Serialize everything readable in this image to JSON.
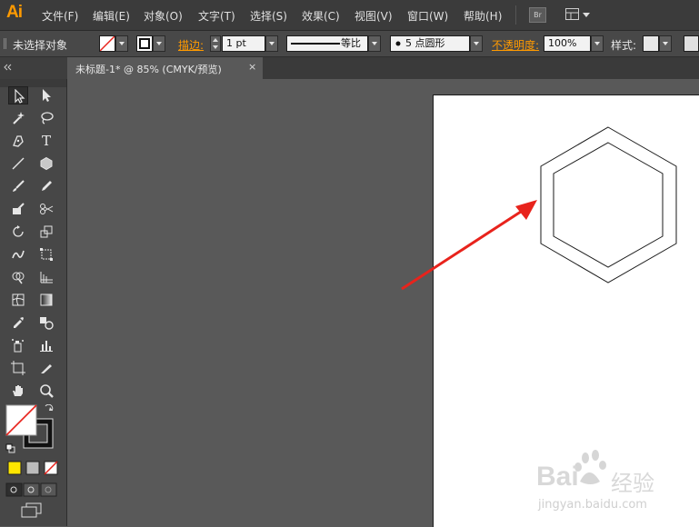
{
  "app": {
    "logo": "Ai",
    "menu": [
      "文件(F)",
      "编辑(E)",
      "对象(O)",
      "文字(T)",
      "选择(S)",
      "效果(C)",
      "视图(V)",
      "窗口(W)",
      "帮助(H)"
    ],
    "bridge_button": "Br"
  },
  "control_bar": {
    "selection_status": "未选择对象",
    "stroke_label": "描边:",
    "stroke_weight": "1 pt",
    "stroke_profile": "等比",
    "brush": "5 点圆形",
    "opacity_label": "不透明度:",
    "opacity_value": "100%",
    "style_label": "样式:"
  },
  "document": {
    "tab_title": "未标题-1* @ 85% (CMYK/预览)",
    "tab_close": "×"
  },
  "watermark": {
    "brand_left": "Bai",
    "brand_right": "经验",
    "url": "jingyan.baidu.com"
  },
  "colors": {
    "accent_orange": "#ff9a00",
    "arrow_red": "#e8231c"
  },
  "icons": [
    "selection-tool-icon",
    "direct-selection-tool-icon",
    "magic-wand-icon",
    "lasso-icon",
    "pen-icon",
    "type-icon",
    "line-icon",
    "polygon-icon",
    "paintbrush-icon",
    "pencil-icon",
    "blob-brush-icon",
    "scissors-icon",
    "rotate-icon",
    "scale-icon",
    "warp-icon",
    "free-transform-icon",
    "shape-builder-icon",
    "perspective-grid-icon",
    "mesh-icon",
    "gradient-icon",
    "eyedropper-icon",
    "blend-icon",
    "symbol-sprayer-icon",
    "column-graph-icon",
    "artboard-icon",
    "slice-icon",
    "hand-icon",
    "zoom-icon"
  ]
}
